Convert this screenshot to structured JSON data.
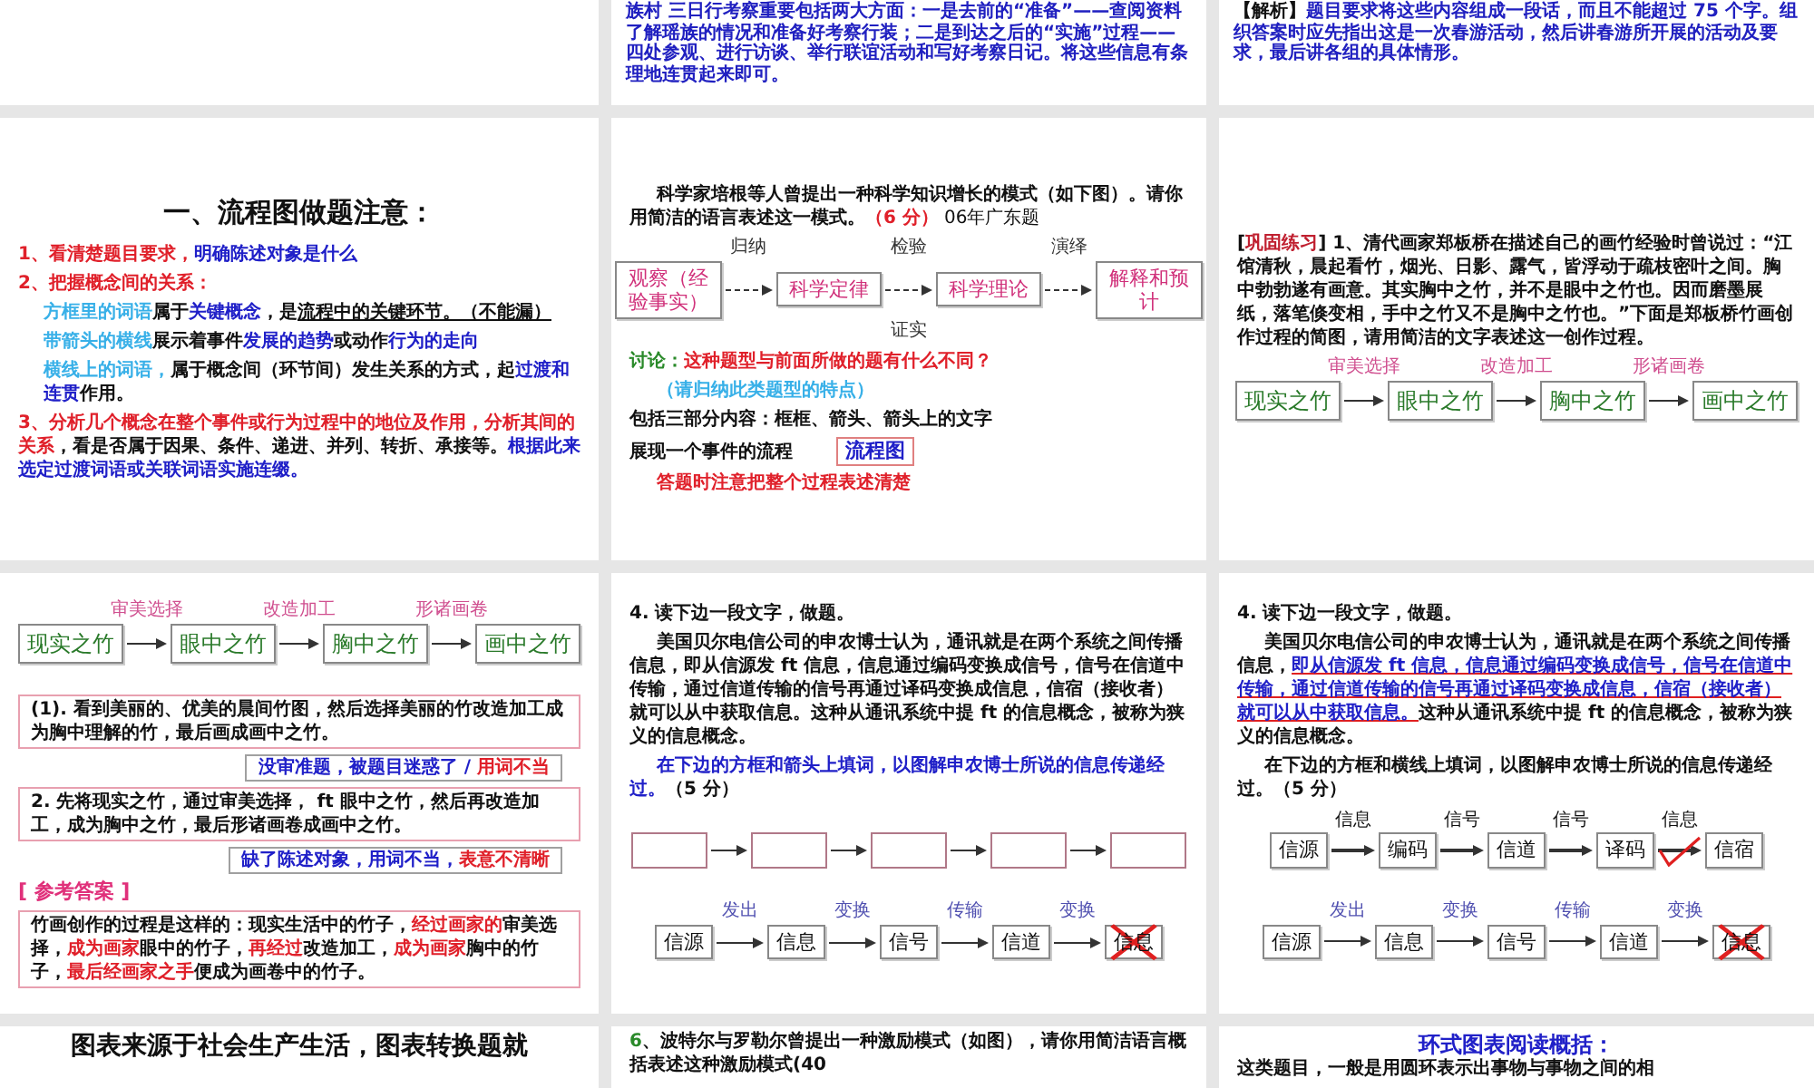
{
  "slides": [
    {
      "kind": "blank"
    },
    {
      "kind": "text",
      "blocks": [
        {
          "kind": "para",
          "runs": [
            {
              "text": "族村 三日行考察重要包括两大方面：一是去前的“准备”——查阅资料了解瑶族的情况和准备好考察行装；二是到达之后的“实施”过程——四处参观、进行访谈、举行联谊活动和写好考察日记。将这些信息有条理地连贯起来即可。",
              "color": "#2020c0"
            }
          ]
        }
      ]
    },
    {
      "kind": "text",
      "blocks": [
        {
          "kind": "para",
          "runs": [
            {
              "text": "【解析】"
            },
            {
              "text": "题目要求将这些内容组成一段话，而且不能超过 75 个字。组织答案时应先指出这是一次春游活动，然后讲春游所开展的活动及要求，最后讲各组的具体情形。",
              "color": "#2020c0"
            }
          ]
        }
      ]
    },
    {
      "kind": "text",
      "blocks": [
        {
          "kind": "title",
          "runs": [
            {
              "text": "一、流程图做题注意："
            }
          ]
        },
        {
          "kind": "para",
          "runs": [
            {
              "text": "1、看清楚题目要求，",
              "color": "#e0202a"
            },
            {
              "text": "明确陈述对象是什么",
              "color": "#2020c8"
            }
          ]
        },
        {
          "kind": "para",
          "runs": [
            {
              "text": "2、把握概念间的关系：",
              "color": "#e0202a"
            }
          ]
        },
        {
          "kind": "sub",
          "runs": [
            {
              "text": "方框里的词语",
              "color": "#38b0e8"
            },
            {
              "text": "属于"
            },
            {
              "text": "关键概念",
              "color": "#2020c8"
            },
            {
              "text": "，是"
            },
            {
              "text": "流程中的关键环节。（不能漏）",
              "underline": true
            }
          ]
        },
        {
          "kind": "sub",
          "runs": [
            {
              "text": "带箭头的横线",
              "color": "#38b0e8"
            },
            {
              "text": "展示着事件"
            },
            {
              "text": "发展的趋势",
              "color": "#2020c8"
            },
            {
              "text": "或动作"
            },
            {
              "text": "行为的走向",
              "color": "#2020c8"
            }
          ]
        },
        {
          "kind": "sub",
          "runs": [
            {
              "text": "横线上的词语，",
              "color": "#38b0e8"
            },
            {
              "text": "属于概念间（环节间）发生关系的方式，起"
            },
            {
              "text": "过渡和连贯",
              "color": "#2020c8"
            },
            {
              "text": "作用。"
            }
          ]
        },
        {
          "kind": "para",
          "runs": [
            {
              "text": "3、分析几个概念在整个事件或行为过程中的地位及作用，分析其间的关系",
              "color": "#e0202a"
            },
            {
              "text": "，看是否属于因果、条件、递进、并列、转折、承接等。"
            },
            {
              "text": "根据此来选定过渡词语或关联词语实施连缀。",
              "color": "#2020c8"
            }
          ]
        }
      ]
    },
    {
      "kind": "text",
      "blocks": [
        {
          "kind": "indent",
          "runs": [
            {
              "text": "科学家培根等人曾提出一种科学知识增长的模式（如下图）。请你用简洁的语言表述这一模式。"
            },
            {
              "text": "（6 分）",
              "color": "#e0202a"
            },
            {
              "text": "06年广东题",
              "kind": "small"
            }
          ]
        },
        {
          "kind": "sketchflow",
          "nodes": [
            {
              "kind": "text",
              "text": "观察（经验事实）"
            },
            {
              "kind": "text",
              "text": "科学定律"
            },
            {
              "kind": "text",
              "text": "科学理论"
            },
            {
              "kind": "text",
              "text": "解释和预计"
            }
          ],
          "links": [
            {
              "above": "归纳"
            },
            {
              "above": "检验",
              "below": "证实"
            },
            {
              "above": "演绎"
            }
          ]
        },
        {
          "kind": "para",
          "runs": [
            {
              "text": "讨论：",
              "color": "#2a8a2a"
            },
            {
              "text": "这种题型与前面所做的题有什么不同？",
              "color": "#e0202a"
            }
          ]
        },
        {
          "kind": "hint",
          "runs": [
            {
              "text": "（请归纳此类题型的特点）",
              "color": "#38b0e8"
            }
          ]
        },
        {
          "kind": "para",
          "runs": [
            {
              "text": "包括三部分内容：框框、箭头、箭头上的文字"
            }
          ]
        },
        {
          "kind": "label_row",
          "text": "展现一个事件的流程",
          "tag": "流程图"
        },
        {
          "kind": "hint",
          "runs": [
            {
              "text": "答题时注意把整个过程表述清楚",
              "color": "#e0202a"
            }
          ]
        }
      ]
    },
    {
      "kind": "text",
      "blocks": [
        {
          "kind": "para",
          "runs": [
            {
              "text": "["
            },
            {
              "text": "巩固练习",
              "color": "#c02030"
            },
            {
              "text": "] 1、清代画家郑板桥在描述自己的画竹经验时曾说过：“江馆清秋，晨起看竹，烟光、日影、露气，皆浮动于疏枝密叶之间。胸中勃勃遂有画意。其实胸中之竹，并不是眼中之竹也。因而磨墨展纸，落笔倏变相，手中之竹又不是胸中之竹也。”下面是郑板桥竹画创作过程的简图，请用简洁的文字表述这一创作过程。"
            }
          ]
        },
        {
          "kind": "bambooflow",
          "nodes": [
            {
              "kind": "text",
              "text": "现实之竹"
            },
            {
              "kind": "text",
              "text": "眼中之竹"
            },
            {
              "kind": "text",
              "text": "胸中之竹"
            },
            {
              "kind": "text",
              "text": "画中之竹"
            }
          ],
          "links": [
            {
              "above": "审美选择"
            },
            {
              "above": "改造加工"
            },
            {
              "above": "形诸画卷"
            }
          ]
        }
      ]
    },
    {
      "kind": "text",
      "blocks": [
        {
          "kind": "bambooflow",
          "nodes": [
            {
              "kind": "text",
              "text": "现实之竹"
            },
            {
              "kind": "text",
              "text": "眼中之竹"
            },
            {
              "kind": "text",
              "text": "胸中之竹"
            },
            {
              "kind": "text",
              "text": "画中之竹"
            }
          ],
          "links": [
            {
              "above": "审美选择"
            },
            {
              "above": "改造加工"
            },
            {
              "above": "形诸画卷"
            }
          ]
        },
        {
          "kind": "framed",
          "runs": [
            {
              "text": "(1). 看到美丽的、优美的晨间竹图，然后选择美丽的竹改造加工成为胸中理解的竹，最后画成画中之竹。"
            }
          ]
        },
        {
          "kind": "note",
          "runs": [
            {
              "text": "没审准题，被题目迷惑了 / ",
              "color": "#2020c8"
            },
            {
              "text": "用词不当",
              "color": "#e0202a"
            }
          ]
        },
        {
          "kind": "framed",
          "runs": [
            {
              "text": "2. 先将现实之竹，通过审美选择， ft 眼中之竹，然后再改造加工，成为胸中之竹，最后形诸画卷成画中之竹。"
            }
          ]
        },
        {
          "kind": "note",
          "runs": [
            {
              "text": "缺了陈述对象，用词不当，",
              "color": "#2020c8"
            },
            {
              "text": "表意不清晰",
              "color": "#e0202a"
            }
          ]
        },
        {
          "kind": "tag",
          "text": "[ 参考答案 ]"
        },
        {
          "kind": "framed",
          "runs": [
            {
              "text": "竹画创作的过程是这样的：现实生活中的竹子，"
            },
            {
              "text": "经过画家的",
              "color": "#e0202a"
            },
            {
              "text": "审美选择，"
            },
            {
              "text": "成为画家",
              "color": "#e0202a"
            },
            {
              "text": "眼中的竹子，"
            },
            {
              "text": "再经过",
              "color": "#e0202a"
            },
            {
              "text": "改造加工，"
            },
            {
              "text": "成为画家",
              "color": "#e0202a"
            },
            {
              "text": "胸中的竹子，"
            },
            {
              "text": "最后经画家之手",
              "color": "#e0202a"
            },
            {
              "text": "便成为画卷中的竹子。"
            }
          ]
        }
      ]
    },
    {
      "kind": "text",
      "blocks": [
        {
          "kind": "para",
          "runs": [
            {
              "text": "4. 读下边一段文字，做题。"
            }
          ]
        },
        {
          "kind": "indent",
          "runs": [
            {
              "text": "美国贝尔电信公司的申农博士认为，通讯就是在两个系统之间传播信息，即从信源发 ft 信息，信息通过编码变换成信号，信号在信道中传输，通过信道传输的信号再通过译码变换成信息，信宿（接收者）就可以从中获取信息。这种从通讯系统中提 ft 的信息概念，被称为狭义的信息概念。"
            }
          ]
        },
        {
          "kind": "indent",
          "runs": [
            {
              "text": "在下边的方框和箭头上填词，以图解申农博士所说的信息传递经过。",
              "color": "#2020c8"
            },
            {
              "text": "（5 分）"
            }
          ]
        },
        {
          "kind": "blankflow",
          "nodes": [
            {
              "kind": "blank"
            },
            {
              "kind": "blank"
            },
            {
              "kind": "blank"
            },
            {
              "kind": "blank"
            },
            {
              "kind": "blank"
            }
          ]
        },
        {
          "kind": "plainflow",
          "nodes": [
            {
              "kind": "text",
              "text": "信源",
              "crossed": false
            },
            {
              "kind": "text",
              "text": "信息",
              "crossed": false
            },
            {
              "kind": "text",
              "text": "信号",
              "crossed": false
            },
            {
              "kind": "text",
              "text": "信道",
              "crossed": false
            },
            {
              "kind": "text",
              "text": "信息",
              "crossed": true
            }
          ],
          "links": [
            {
              "above": "发出"
            },
            {
              "above": "变换"
            },
            {
              "above": "传输"
            },
            {
              "above": "变换"
            }
          ]
        }
      ]
    },
    {
      "kind": "text",
      "blocks": [
        {
          "kind": "para",
          "runs": [
            {
              "text": "4. 读下边一段文字，做题。"
            }
          ]
        },
        {
          "kind": "indent",
          "runs": [
            {
              "text": "美国贝尔电信公司的申农博士认为，通讯就是在两个系统之间传播信息，"
            },
            {
              "text": "即从信源发 ft 信息，信息通过编码变换成信号，信号在信道中传输，通过信道传输的信号再通过译码变换成信息，信宿（接收者）就可以从中获取信息。",
              "color": "#2020c8",
              "underline": true
            },
            {
              "text": "这种从通讯系统中提 ft 的信息概念，被称为狭义的信息概念。"
            }
          ]
        },
        {
          "kind": "indent",
          "runs": [
            {
              "text": "在下边的方框和横线上填词，以图解申农博士所说的信息传递经过。（5 分）"
            }
          ]
        },
        {
          "kind": "boldflow",
          "nodes": [
            {
              "kind": "text",
              "text": "信源"
            },
            {
              "kind": "text",
              "text": "编码"
            },
            {
              "kind": "text",
              "text": "信道"
            },
            {
              "kind": "text",
              "text": "译码"
            },
            {
              "kind": "text",
              "text": "信宿"
            }
          ],
          "links": [
            {
              "above": "信息",
              "checked": false
            },
            {
              "above": "信号",
              "checked": false
            },
            {
              "above": "信号",
              "checked": false
            },
            {
              "above": "信息",
              "checked": true
            }
          ]
        },
        {
          "kind": "plainflow",
          "nodes": [
            {
              "kind": "text",
              "text": "信源",
              "crossed": false
            },
            {
              "kind": "text",
              "text": "信息",
              "crossed": false
            },
            {
              "kind": "text",
              "text": "信号",
              "crossed": false
            },
            {
              "kind": "text",
              "text": "信道",
              "crossed": false
            },
            {
              "kind": "text",
              "text": "信息",
              "crossed": true
            }
          ],
          "links": [
            {
              "above": "发出"
            },
            {
              "above": "变换"
            },
            {
              "above": "传输"
            },
            {
              "above": "变换"
            }
          ]
        }
      ]
    },
    {
      "kind": "text",
      "blocks": [
        {
          "kind": "title",
          "runs": [
            {
              "text": "图表来源于社会生产生活，图表转换题就"
            }
          ]
        }
      ]
    },
    {
      "kind": "text",
      "blocks": [
        {
          "kind": "para",
          "runs": [
            {
              "text": "6",
              "color": "#2a8a2a"
            },
            {
              "text": "、波特尔与罗勒尔曾提出一种激励模式（如图），请你用简洁语言概括表述这种激励模式(40"
            }
          ]
        }
      ]
    },
    {
      "kind": "text",
      "blocks": [
        {
          "kind": "heading",
          "runs": [
            {
              "text": "环式图表阅读概括：",
              "color": "#2020c8"
            }
          ]
        },
        {
          "kind": "para",
          "runs": [
            {
              "text": "这类题目，一般是用圆环表示出事物与事物之间的相"
            }
          ]
        }
      ]
    }
  ]
}
